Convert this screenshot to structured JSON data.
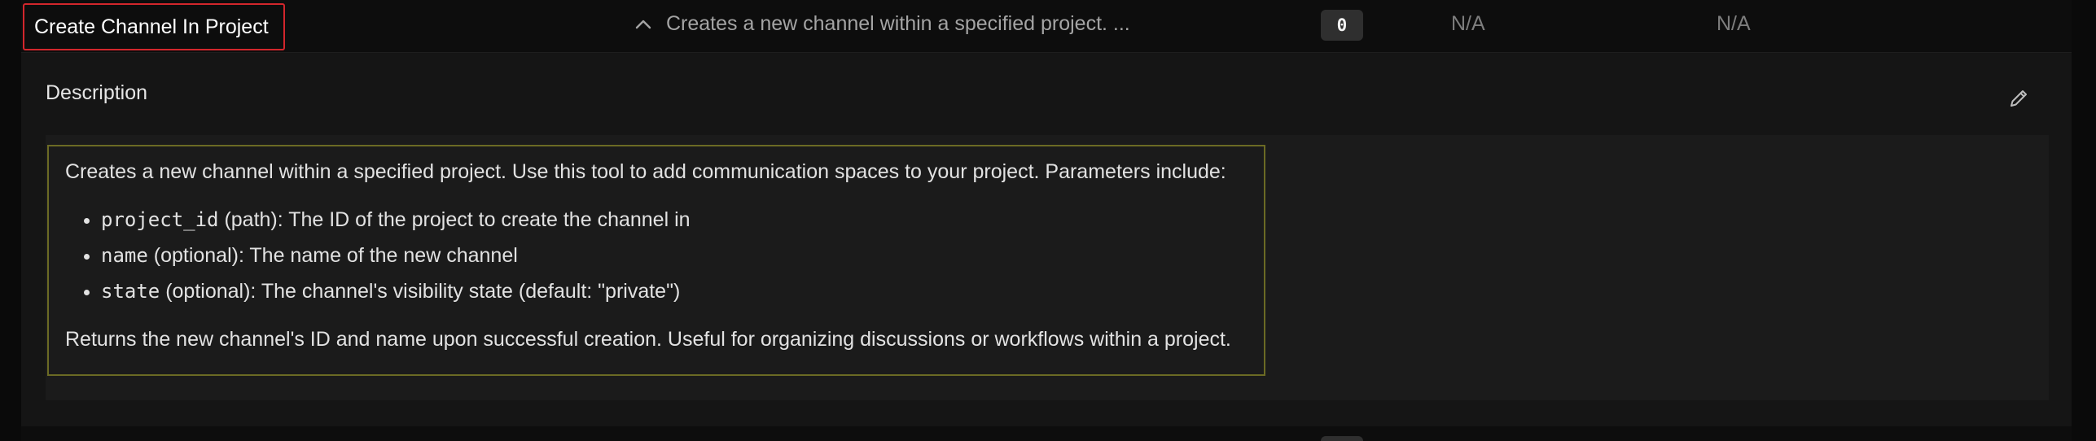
{
  "row": {
    "tool_name": "Create Channel In Project",
    "summary": "Creates a new channel within a specified project. ...",
    "count_badge": "0",
    "col_a": "N/A",
    "col_b": "N/A",
    "expand_icon": "chevron-up-icon"
  },
  "detail": {
    "label": "Description",
    "edit_icon": "pencil-icon",
    "intro": "Creates a new channel within a specified project. Use this tool to add communication spaces to your project. Parameters include:",
    "params": [
      {
        "name": "project_id",
        "desc": " (path): The ID of the project to create the channel in"
      },
      {
        "name": "name",
        "desc": " (optional): The name of the new channel"
      },
      {
        "name": "state",
        "desc": " (optional): The channel's visibility state (default: \"private\")"
      }
    ],
    "outro": "Returns the new channel's ID and name upon successful creation. Useful for organizing discussions or workflows within a project."
  },
  "colors": {
    "selection_outline": "#d2262c",
    "description_outline": "#6b6a24",
    "badge_bg": "#2f2f2f"
  }
}
